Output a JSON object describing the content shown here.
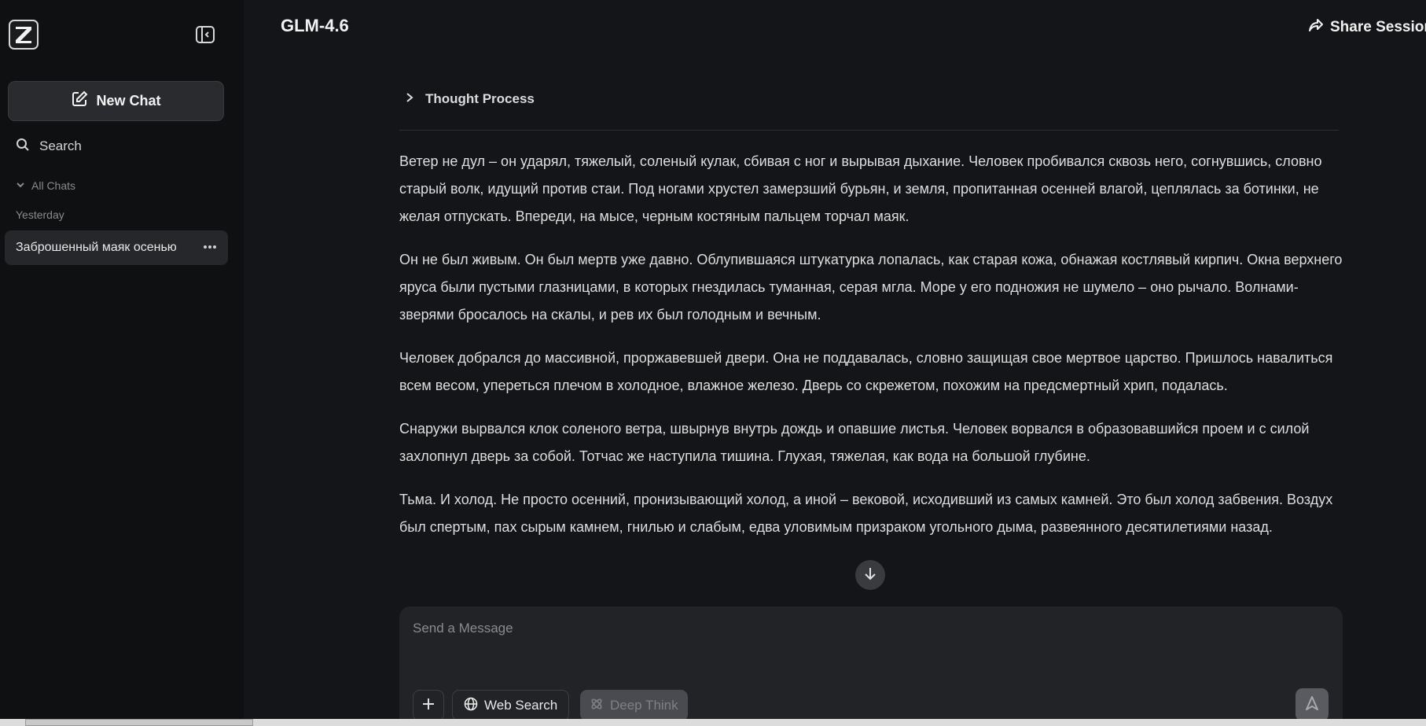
{
  "sidebar": {
    "logo_letter": "Z",
    "new_chat_label": "New Chat",
    "search_label": "Search",
    "all_chats_label": "All Chats",
    "group_label": "Yesterday",
    "chats": [
      {
        "title": "Заброшенный маяк осенью"
      }
    ]
  },
  "header": {
    "model_name": "GLM-4.6",
    "share_label": "Share Session"
  },
  "conversation": {
    "thought_process_label": "Thought Process",
    "paragraphs": [
      "Ветер не дул – он ударял, тяжелый, соленый кулак, сбивая с ног и вырывая дыхание. Человек пробивался сквозь него, согнувшись, словно старый волк, идущий против стаи. Под ногами хрустел замерзший бурьян, и земля, пропитанная осенней влагой, цеплялась за ботинки, не желая отпускать. Впереди, на мысе, черным костяным пальцем торчал маяк.",
      "Он не был живым. Он был мертв уже давно. Облупившаяся штукатурка лопалась, как старая кожа, обнажая костлявый кирпич. Окна верхнего яруса были пустыми глазницами, в которых гнездилась туманная, серая мгла. Море у его подножия не шумело – оно рычало. Волнами-зверями бросалось на скалы, и рев их был голодным и вечным.",
      "Человек добрался до массивной, проржавевшей двери. Она не поддавалась, словно защищая свое мертвое царство. Пришлось навалиться всем весом, упереться плечом в холодное, влажное железо. Дверь со скрежетом, похожим на предсмертный хрип, подалась.",
      "Снаружи вырвался клок соленого ветра, швырнув внутрь дождь и опавшие листья. Человек ворвался в образовавшийся проем и с силой захлопнул дверь за собой. Тотчас же наступила тишина. Глухая, тяжелая, как вода на большой глубине.",
      "Тьма. И холод. Не просто осенний, пронизывающий холод, а иной – вековой, исходивший из самых камней. Это был холод забвения. Воздух был спертым, пах сырым камнем, гнилью и слабым, едва уловимым призраком угольного дыма, развеянного десятилетиями назад."
    ]
  },
  "composer": {
    "placeholder": "Send a Message",
    "web_search_label": "Web Search",
    "deep_think_label": "Deep Think"
  },
  "colors": {
    "background": "#141518",
    "sidebar": "#0f1012",
    "accent_text": "#f2f2f2"
  }
}
